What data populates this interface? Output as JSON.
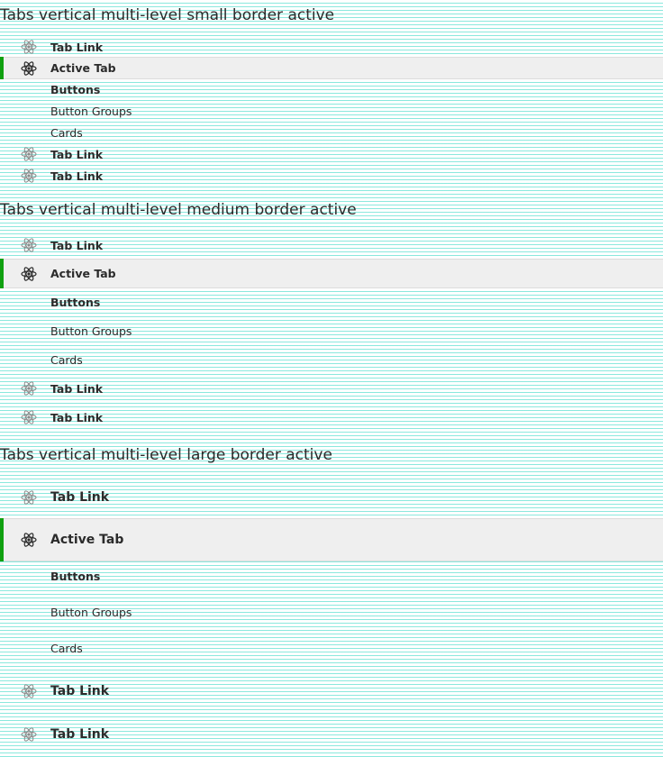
{
  "sections": [
    {
      "title": "Tabs vertical multi-level small border active",
      "items": [
        {
          "label": "Tab Link",
          "icon": "atom-icon"
        },
        {
          "label": "Active Tab",
          "icon": "atom-icon",
          "active": true
        },
        {
          "label": "Buttons"
        },
        {
          "label": "Button Groups"
        },
        {
          "label": "Cards"
        },
        {
          "label": "Tab Link",
          "icon": "atom-icon"
        },
        {
          "label": "Tab Link",
          "icon": "atom-icon"
        }
      ]
    },
    {
      "title": "Tabs vertical multi-level medium border active",
      "items": [
        {
          "label": "Tab Link",
          "icon": "atom-icon"
        },
        {
          "label": "Active Tab",
          "icon": "atom-icon",
          "active": true
        },
        {
          "label": "Buttons"
        },
        {
          "label": "Button Groups"
        },
        {
          "label": "Cards"
        },
        {
          "label": "Tab Link",
          "icon": "atom-icon"
        },
        {
          "label": "Tab Link",
          "icon": "atom-icon"
        }
      ]
    },
    {
      "title": "Tabs vertical multi-level large border active",
      "items": [
        {
          "label": "Tab Link",
          "icon": "atom-icon"
        },
        {
          "label": "Active Tab",
          "icon": "atom-icon",
          "active": true
        },
        {
          "label": "Buttons"
        },
        {
          "label": "Button Groups"
        },
        {
          "label": "Cards"
        },
        {
          "label": "Tab Link",
          "icon": "atom-icon"
        },
        {
          "label": "Tab Link",
          "icon": "atom-icon"
        }
      ]
    }
  ],
  "colors": {
    "active_border": "#10a010",
    "active_background": "#efefef",
    "text": "#2b2b2b",
    "icon_inactive": "#8a8a8a"
  }
}
